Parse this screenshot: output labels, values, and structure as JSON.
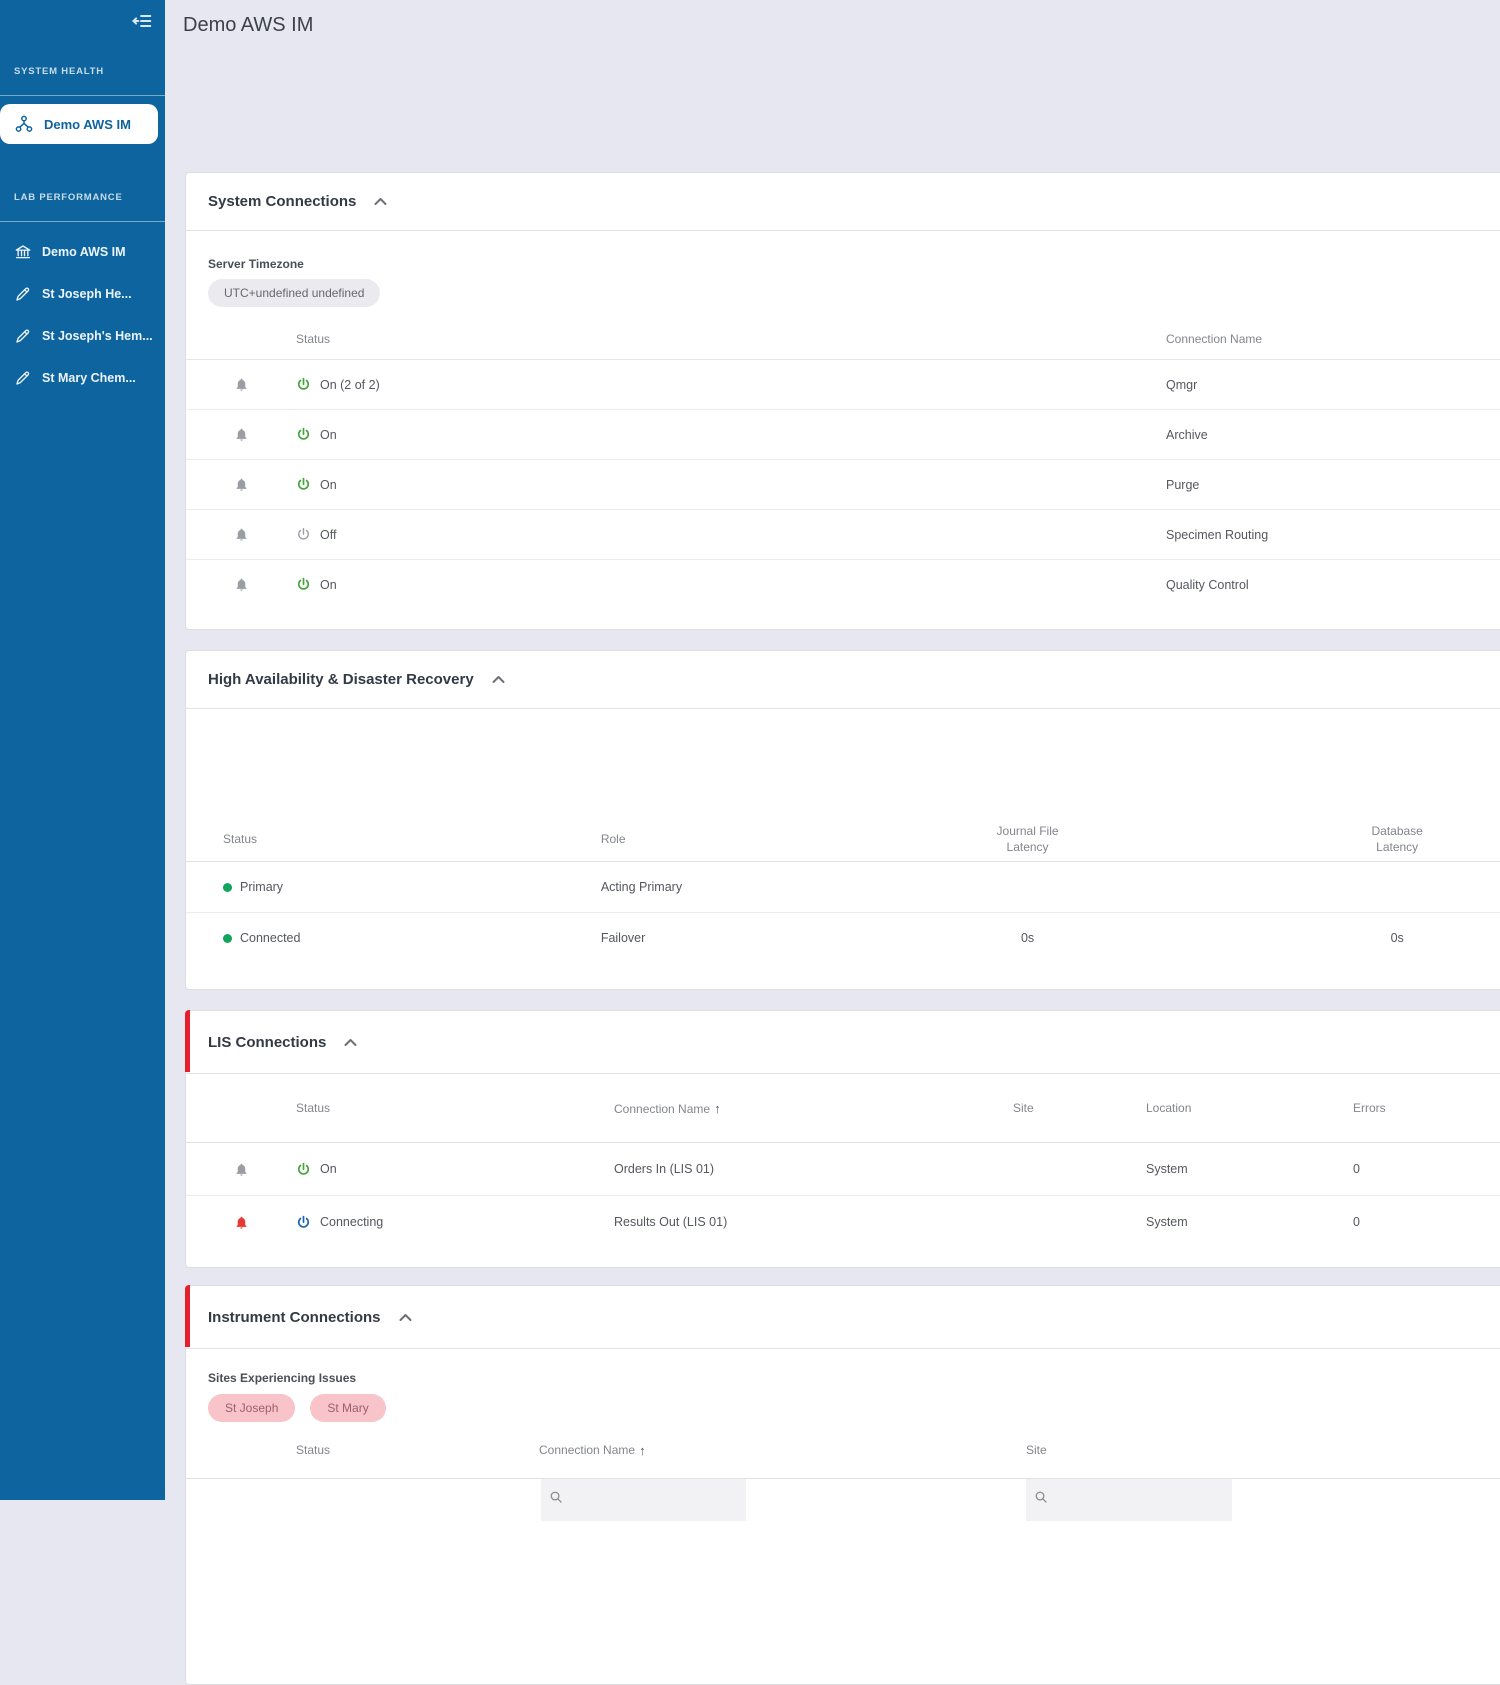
{
  "header": {
    "title": "Demo AWS IM"
  },
  "sidebar": {
    "sections": [
      {
        "label": "SYSTEM HEALTH",
        "items": [
          {
            "label": "Demo AWS IM"
          }
        ]
      },
      {
        "label": "LAB PERFORMANCE",
        "items": [
          {
            "label": "Demo AWS IM"
          },
          {
            "label": "St Joseph He..."
          },
          {
            "label": "St Joseph's Hem..."
          },
          {
            "label": "St Mary Chem..."
          }
        ]
      }
    ]
  },
  "panels": {
    "system_connections": {
      "title": "System Connections",
      "timezone_label": "Server Timezone",
      "timezone_value": "UTC+undefined undefined",
      "columns": {
        "status": "Status",
        "connection_name": "Connection Name"
      },
      "rows": [
        {
          "status": "On (2 of 2)",
          "connection_name": "Qmgr"
        },
        {
          "status": "On",
          "connection_name": "Archive"
        },
        {
          "status": "On",
          "connection_name": "Purge"
        },
        {
          "status": "Off",
          "connection_name": "Specimen Routing"
        },
        {
          "status": "On",
          "connection_name": "Quality Control"
        }
      ]
    },
    "ha_dr": {
      "title": "High Availability & Disaster Recovery",
      "columns": {
        "status": "Status",
        "role": "Role",
        "journal_l1": "Journal File",
        "journal_l2": "Latency",
        "database_l1": "Database",
        "database_l2": "Latency"
      },
      "rows": [
        {
          "status": "Primary",
          "role": "Acting Primary",
          "journal": "",
          "database": ""
        },
        {
          "status": "Connected",
          "role": "Failover",
          "journal": "0s",
          "database": "0s"
        }
      ]
    },
    "lis_connections": {
      "title": "LIS Connections",
      "columns": {
        "status": "Status",
        "connection_name": "Connection Name",
        "sort_arrow": "↑",
        "site": "Site",
        "location": "Location",
        "errors": "Errors"
      },
      "rows": [
        {
          "status": "On",
          "connection_name": "Orders In (LIS 01)",
          "site": "",
          "location": "System",
          "errors": "0"
        },
        {
          "status": "Connecting",
          "connection_name": "Results Out (LIS 01)",
          "site": "",
          "location": "System",
          "errors": "0"
        }
      ]
    },
    "instrument_connections": {
      "title": "Instrument Connections",
      "sites_issues_label": "Sites Experiencing Issues",
      "site_chips": [
        "St Joseph",
        "St Mary"
      ],
      "columns": {
        "status": "Status",
        "connection_name": "Connection Name",
        "sort_arrow": "↑",
        "site": "Site"
      }
    }
  },
  "colors": {
    "sidebar_blue": "#0e649e",
    "content_background": "#e6e7f0",
    "accent_red": "#e4202c",
    "status_on_green": "#43a53c",
    "status_off_gray": "#9b9da4",
    "status_connecting_blue": "#1b66ae",
    "alert_red": "#e53935",
    "ha_dot_green": "#12a45c",
    "chip_pink_bg": "#f8c3c9",
    "chip_pink_text": "#9c606a"
  }
}
